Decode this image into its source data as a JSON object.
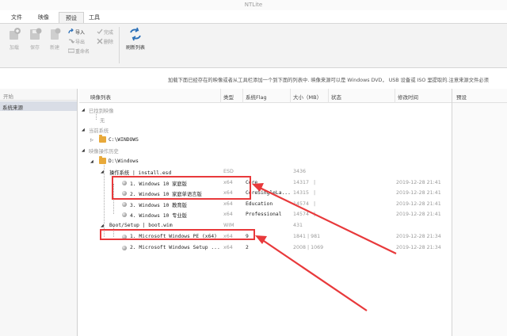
{
  "window": {
    "title": "NTLite"
  },
  "tabs": [
    {
      "label": "文件",
      "active": false
    },
    {
      "label": "映像",
      "active": false
    },
    {
      "label": "预设",
      "active": true
    },
    {
      "label": "工具",
      "active": false
    }
  ],
  "ribbon": {
    "add": "加载",
    "save": "保存",
    "new": "新建",
    "import": "导入",
    "export": "导出",
    "rename": "重命名",
    "done": "完成",
    "delete": "删除",
    "refresh": "刷新列表"
  },
  "info_bar": "加载下面已经存在的映像或者从工具栏添加一个到下面的列表中. 映像来源可以是 Windows DVD， USB 设备或 ISO 里提取的.注意来源文件必须",
  "left_panel": {
    "header": "开始",
    "items": [
      "系统来源"
    ]
  },
  "columns": [
    "映像列表",
    "类型",
    "系统Flag",
    "大小（MB）",
    "状态",
    "修改时间"
  ],
  "right_panel": {
    "header": "预设"
  },
  "tree": {
    "loaded_images": "已找到映像",
    "none": "无",
    "current_system": "当前系统",
    "c_drive": "C:\\WINDOWS",
    "history": "映像操作历史",
    "d_drive": "D:\\Windows",
    "install_group": {
      "name": "操作系统  |  install.esd",
      "type": "ESD",
      "size": "3436"
    },
    "install_images": [
      {
        "name": "1. Windows 10 家庭版",
        "type": "x64",
        "flag": "Core",
        "size": "14317",
        "status": "|",
        "modified": "2019-12-28 21:41"
      },
      {
        "name": "2. Windows 10 家庭单语言版",
        "type": "x64",
        "flag": "CoreSingleLa...",
        "size": "14315",
        "status": "|",
        "modified": "2019-12-28 21:41"
      },
      {
        "name": "3. Windows 10 教育版",
        "type": "x64",
        "flag": "Education",
        "size": "14574",
        "status": "|",
        "modified": "2019-12-28 21:41"
      },
      {
        "name": "4. Windows 10 专业版",
        "type": "x64",
        "flag": "Professional",
        "size": "14574",
        "status": "|",
        "modified": "2019-12-28 21:41"
      }
    ],
    "boot_group": {
      "name": "Boot/Setup  |  boot.wim",
      "type": "WIM",
      "size": "431"
    },
    "boot_images": [
      {
        "name": "1. Microsoft Windows PE (x64)",
        "type": "x64",
        "flag": "9",
        "size": "1841 | 981",
        "modified": "2019-12-28 21:34"
      },
      {
        "name": "2. Microsoft Windows Setup ...",
        "type": "x64",
        "flag": "2",
        "size": "2008 | 1069",
        "modified": "2019-12-28 21:34"
      }
    ]
  },
  "colors": {
    "annotation": "#e8393b",
    "folder": "#e8a93a",
    "selection": "#d9dde6"
  }
}
